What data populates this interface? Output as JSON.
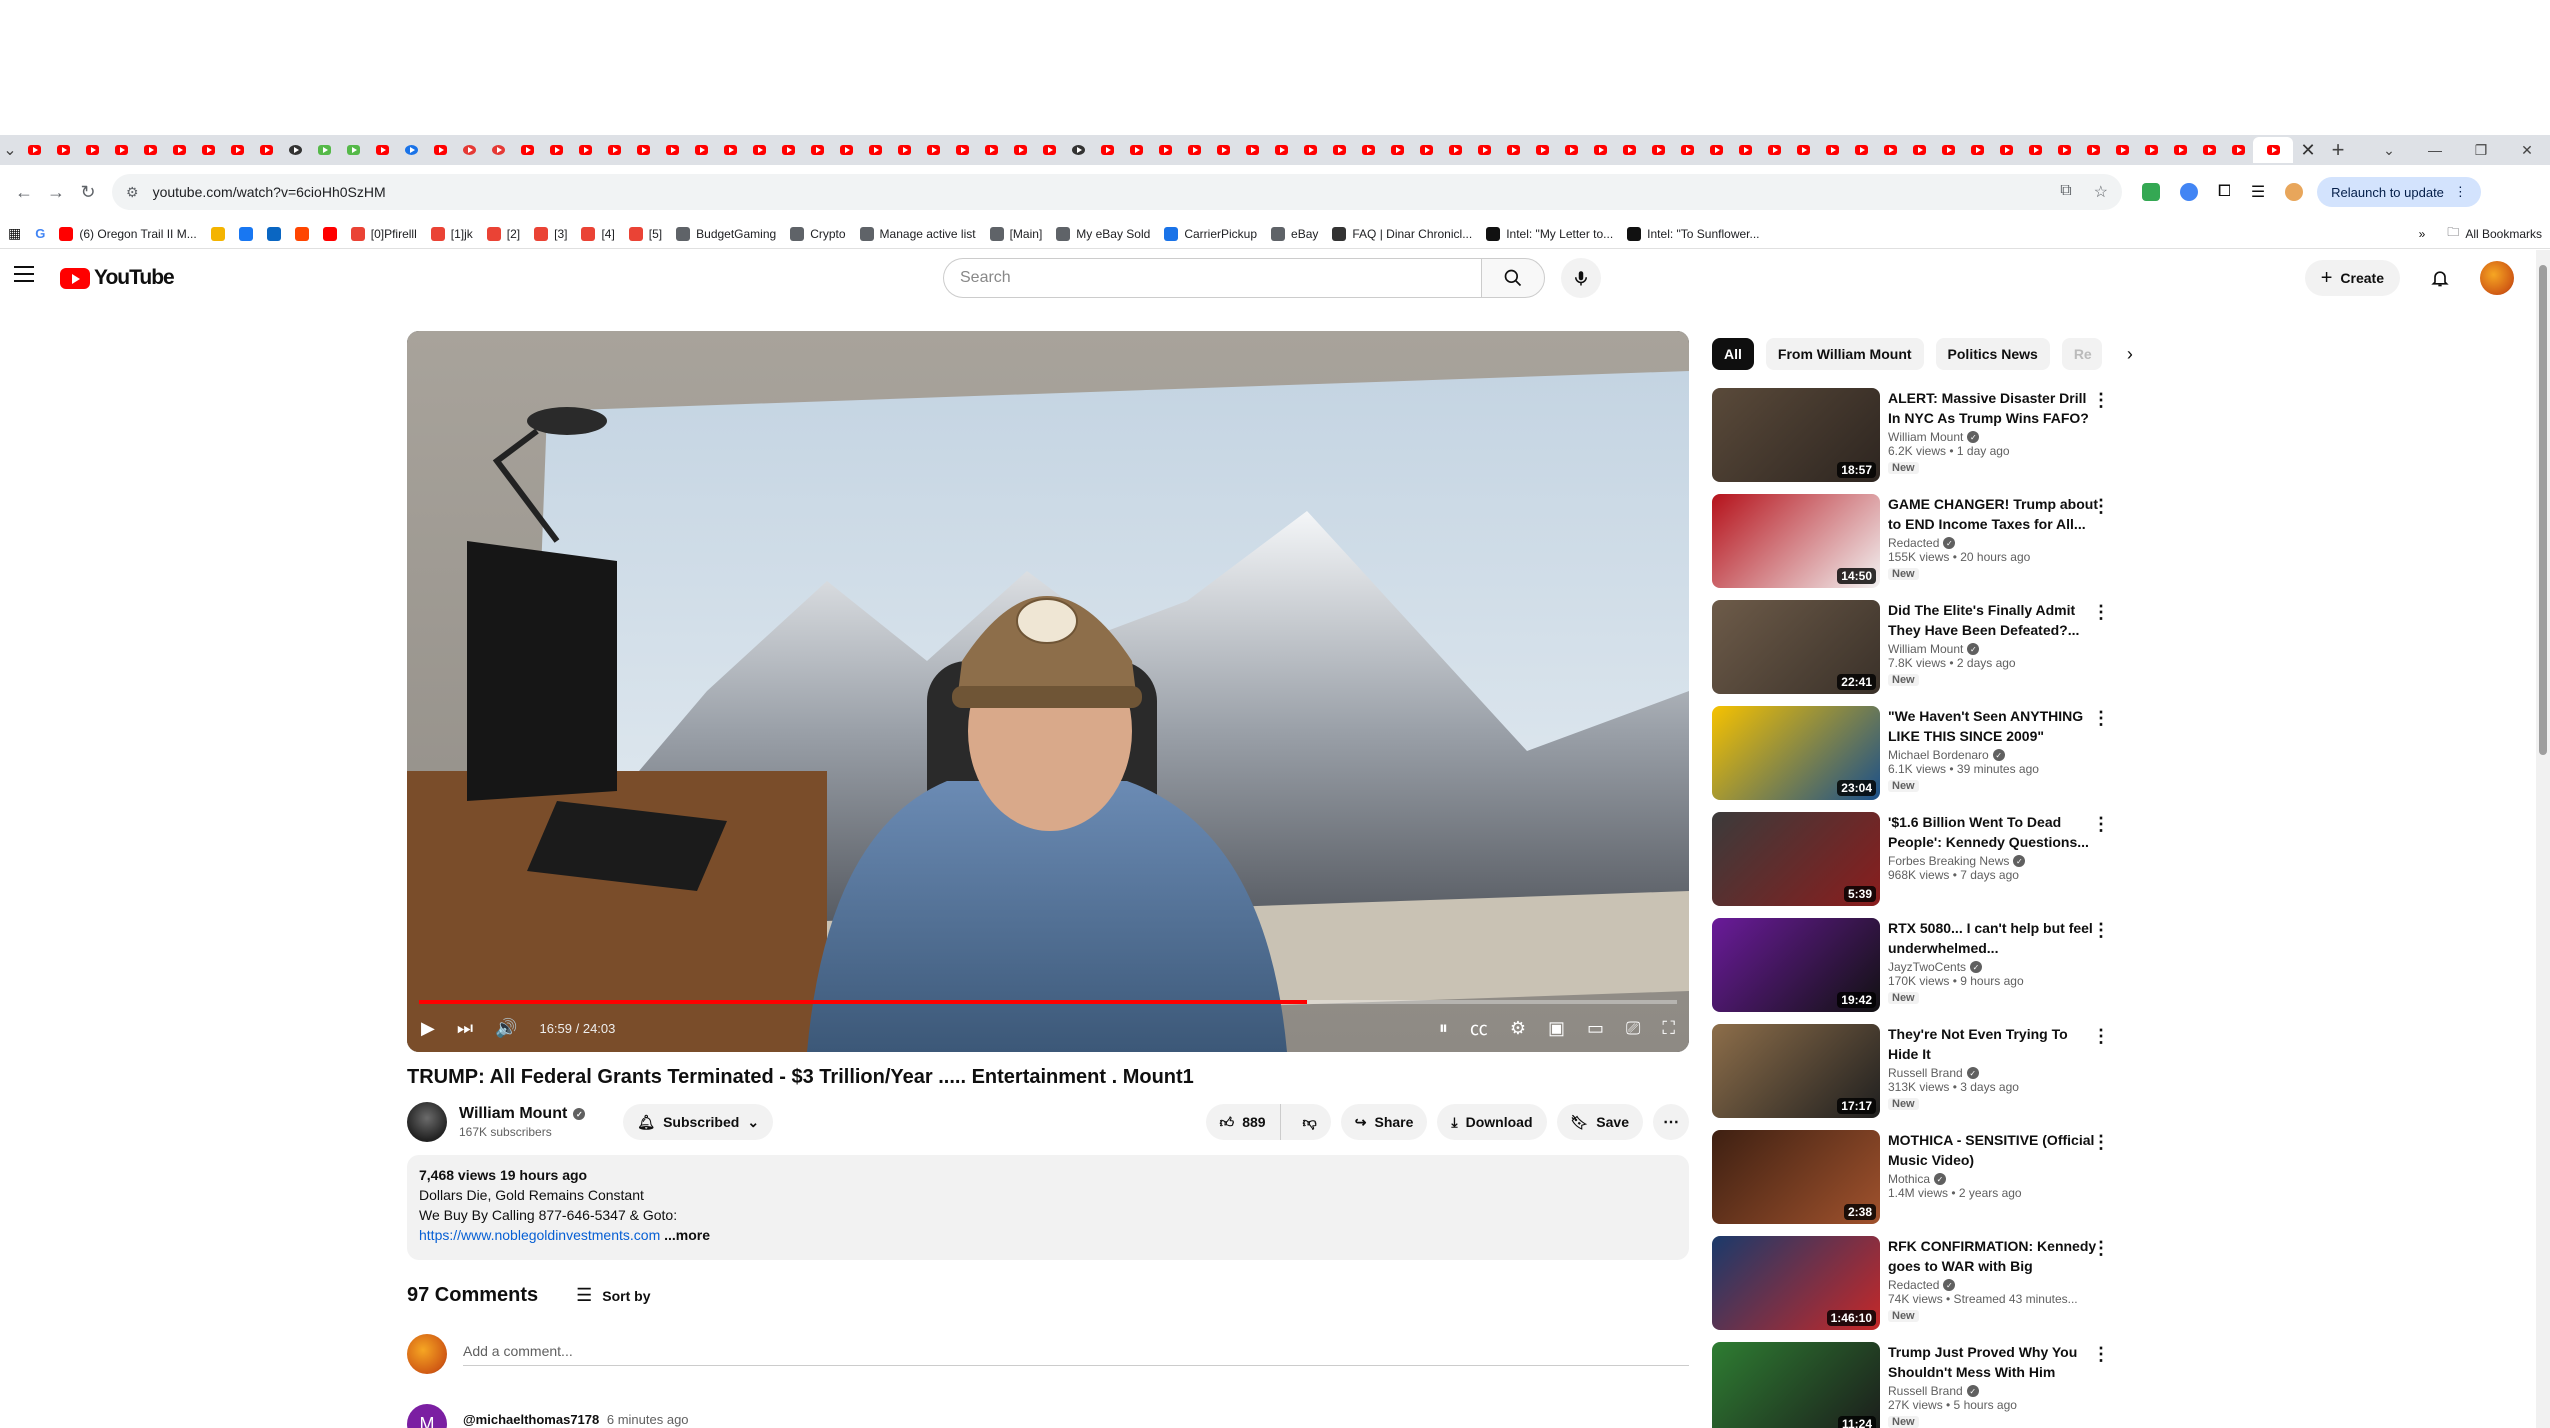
{
  "browser": {
    "url": "youtube.com/watch?v=6cioHh0SzHM",
    "relaunch_label": "Relaunch to update",
    "bookmarks": [
      {
        "label": "(6) Oregon Trail II M...",
        "color": "#ff0000"
      },
      {
        "label": "",
        "color": "#f4b400"
      },
      {
        "label": "",
        "color": "#1877f2"
      },
      {
        "label": "",
        "color": "#0a66c2"
      },
      {
        "label": "",
        "color": "#ff4500"
      },
      {
        "label": "",
        "color": "#ff0000"
      },
      {
        "label": "[0]Pfirelll",
        "color": "#ea4335"
      },
      {
        "label": "[1]jk",
        "color": "#ea4335"
      },
      {
        "label": "[2]",
        "color": "#ea4335"
      },
      {
        "label": "[3]",
        "color": "#ea4335"
      },
      {
        "label": "[4]",
        "color": "#ea4335"
      },
      {
        "label": "[5]",
        "color": "#ea4335"
      },
      {
        "label": "BudgetGaming",
        "color": "#5f6368"
      },
      {
        "label": "Crypto",
        "color": "#5f6368"
      },
      {
        "label": "Manage active list",
        "color": "#5f6368"
      },
      {
        "label": "[Main]",
        "color": "#5f6368"
      },
      {
        "label": "My eBay Sold",
        "color": "#5f6368"
      },
      {
        "label": "CarrierPickup",
        "color": "#1a73e8"
      },
      {
        "label": "eBay",
        "color": "#5f6368"
      },
      {
        "label": "FAQ | Dinar Chronicl...",
        "color": "#333333"
      },
      {
        "label": "Intel: \"My Letter to...",
        "color": "#111111"
      },
      {
        "label": "Intel: \"To Sunflower...",
        "color": "#111111"
      }
    ],
    "all_bookmarks_label": "All Bookmarks"
  },
  "masthead": {
    "logo_text": "YouTube",
    "search_placeholder": "Search",
    "create_label": "Create"
  },
  "player": {
    "time": "16:59 / 24:03",
    "progress_fraction": 0.706
  },
  "video": {
    "title": "TRUMP: All Federal Grants Terminated - $3 Trillion/Year ..... Entertainment . Mount1",
    "channel": "William Mount",
    "subscribers": "167K subscribers",
    "subscribe_label": "Subscribed",
    "likes": "889",
    "share_label": "Share",
    "download_label": "Download",
    "save_label": "Save"
  },
  "description": {
    "stats": "7,468 views  19 hours ago",
    "line1": "Dollars Die, Gold Remains Constant",
    "line2": "We Buy By Calling 877-646-5347 & Goto:",
    "link": "https://www.noblegoldinvestments.com",
    "more": "...more"
  },
  "comments": {
    "count_label": "97 Comments",
    "sort_label": "Sort by",
    "add_placeholder": "Add a comment...",
    "first_author": "@michaelthomas7178",
    "first_time": "6 minutes ago",
    "first_initial": "M"
  },
  "chips": [
    "All",
    "From William Mount",
    "Politics News",
    "Re"
  ],
  "recommendations": [
    {
      "title": "ALERT: Massive Disaster Drill In NYC As Trump Wins FAFO? ........",
      "channel": "William Mount",
      "stats": "6.2K views  •  1 day ago",
      "badge": "New",
      "duration": "18:57"
    },
    {
      "title": "GAME CHANGER! Trump about to END Income Taxes for All...",
      "channel": "Redacted",
      "stats": "155K views  •  20 hours ago",
      "badge": "New",
      "duration": "14:50"
    },
    {
      "title": "Did The Elite's Finally Admit They Have Been Defeated?...",
      "channel": "William Mount",
      "stats": "7.8K views  •  2 days ago",
      "badge": "New",
      "duration": "22:41"
    },
    {
      "title": "\"We Haven't Seen ANYTHING LIKE THIS SINCE 2009\"",
      "channel": "Michael Bordenaro",
      "stats": "6.1K views  •  39 minutes ago",
      "badge": "New",
      "duration": "23:04"
    },
    {
      "title": "'$1.6 Billion Went To Dead People': Kennedy Questions...",
      "channel": "Forbes Breaking News",
      "stats": "968K views  •  7 days ago",
      "badge": "",
      "duration": "5:39"
    },
    {
      "title": "RTX 5080... I can't help but feel underwhelmed...",
      "channel": "JayzTwoCents",
      "stats": "170K views  •  9 hours ago",
      "badge": "New",
      "duration": "19:42"
    },
    {
      "title": "They're Not Even Trying To Hide It",
      "channel": "Russell Brand",
      "stats": "313K views  •  3 days ago",
      "badge": "New",
      "duration": "17:17"
    },
    {
      "title": "MOTHICA - SENSITIVE (Official Music Video)",
      "channel": "Mothica",
      "stats": "1.4M views  •  2 years ago",
      "badge": "",
      "duration": "2:38"
    },
    {
      "title": "RFK CONFIRMATION: Kennedy goes to WAR with Big Pharma...",
      "channel": "Redacted",
      "stats": "74K views  •  Streamed 43 minutes...",
      "badge": "New",
      "duration": "1:46:10"
    },
    {
      "title": "Trump Just Proved Why You Shouldn't Mess With Him",
      "channel": "Russell Brand",
      "stats": "27K views  •  5 hours ago",
      "badge": "New",
      "duration": "11:24"
    }
  ]
}
